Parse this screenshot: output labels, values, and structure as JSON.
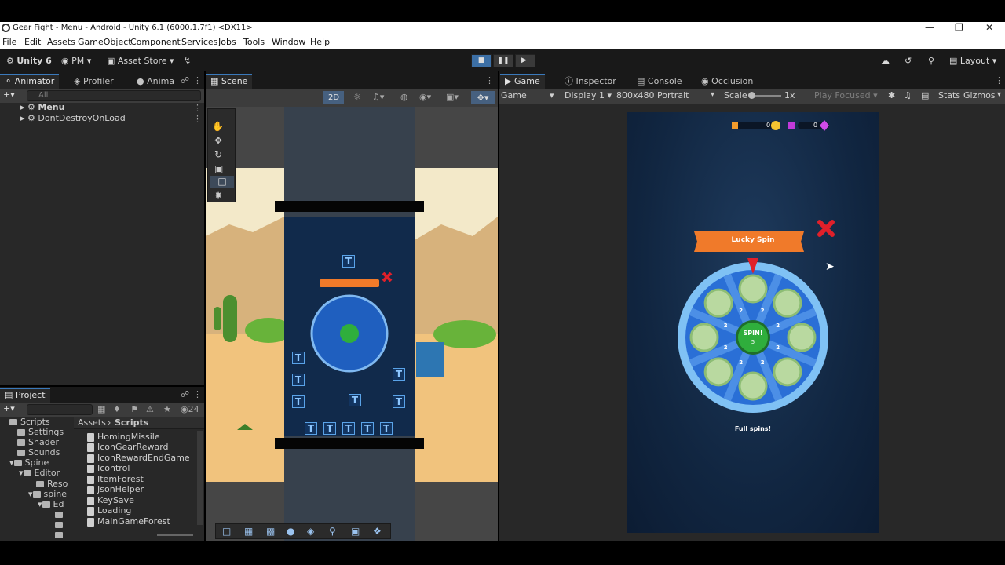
{
  "window": {
    "title": "Gear Fight - Menu - Android - Unity 6.1 (6000.1.7f1) <DX11>"
  },
  "menu": [
    "File",
    "Edit",
    "Assets",
    "GameObject",
    "Component",
    "Services",
    "Jobs",
    "Tools",
    "Window",
    "Help"
  ],
  "toolbar": {
    "unity_label": "Unity 6",
    "account_label": "PM",
    "asset_store_label": "Asset Store",
    "layout_label": "Layout"
  },
  "left_tabs": [
    "Animator",
    "Profiler",
    "Anima"
  ],
  "hierarchy": {
    "search_placeholder": "All",
    "items": [
      "Menu",
      "DontDestroyOnLoad"
    ]
  },
  "scene": {
    "tab_label": "Scene",
    "mode_2d": "2D"
  },
  "game_tabs": {
    "game": "Game",
    "inspector": "Inspector",
    "console": "Console",
    "occlusion": "Occlusion"
  },
  "game_bar": {
    "mode": "Game",
    "display": "Display 1",
    "resolution": "800x480 Portrait",
    "scale_label": "Scale",
    "scale_value": "1x",
    "play_focused": "Play Focused",
    "stats": "Stats",
    "gizmos": "Gizmos"
  },
  "project": {
    "tab_label": "Project",
    "count": "24",
    "breadcrumb": [
      "Assets",
      "Scripts"
    ],
    "tree": [
      "Scripts",
      "Settings",
      "Shader",
      "Sounds",
      "Spine",
      "Editor",
      "Reso",
      "spine",
      "Ed"
    ],
    "files": [
      "HomingMissile",
      "IconGearReward",
      "IconRewardEndGame",
      "Icontrol",
      "ItemForest",
      "JsonHelper",
      "KeySave",
      "Loading",
      "MainGameForest"
    ]
  },
  "game_ui": {
    "counter_gear": "0",
    "counter_gem": "0",
    "wheel_title": "Lucky Spin",
    "spin_label": "SPIN!",
    "spin_count": "5",
    "footer": "Full spins!",
    "slot_values": [
      "2",
      "2",
      "2",
      "2",
      "2",
      "2",
      "2",
      "2"
    ]
  },
  "colors": {
    "accent": "#3a79bb",
    "wheel_blue": "#2a6fd6",
    "spin_green": "#2fae3c",
    "banner_orange": "#f07a2a",
    "close_red": "#e0202a"
  }
}
